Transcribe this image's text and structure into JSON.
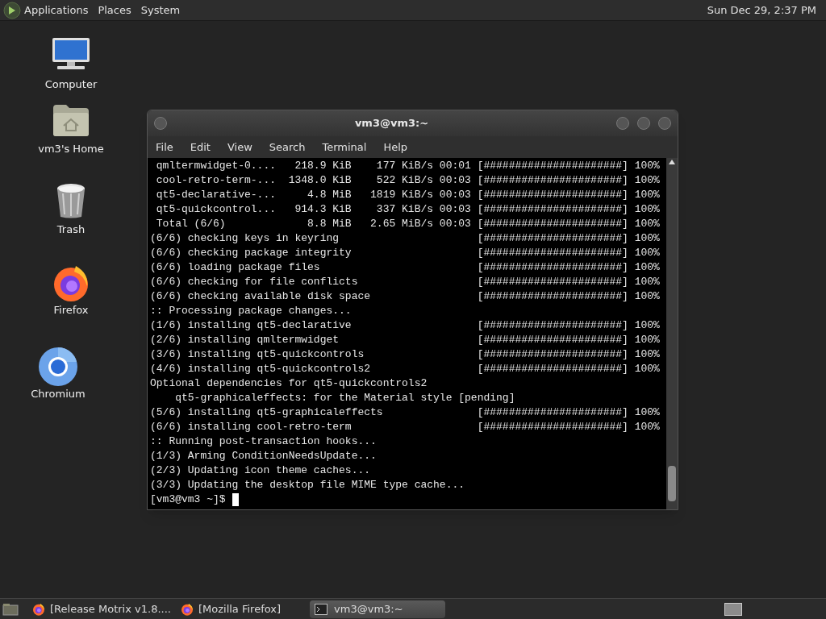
{
  "top_panel": {
    "menus": [
      "Applications",
      "Places",
      "System"
    ],
    "clock": "Sun Dec 29, 2:37 PM"
  },
  "desktop_icons": [
    {
      "kind": "computer",
      "label": "Computer"
    },
    {
      "kind": "home",
      "label": "vm3's Home"
    },
    {
      "kind": "trash",
      "label": "Trash"
    },
    {
      "kind": "firefox",
      "label": "Firefox"
    },
    {
      "kind": "chromium",
      "label": "Chromium"
    }
  ],
  "terminal_window": {
    "title": "vm3@vm3:~",
    "menus": [
      "File",
      "Edit",
      "View",
      "Search",
      "Terminal",
      "Help"
    ],
    "lines": [
      {
        "text": " qmltermwidget-0....   218.9 KiB    177 KiB/s 00:01",
        "bar": "[######################] 100%"
      },
      {
        "text": " cool-retro-term-...  1348.0 KiB    522 KiB/s 00:03",
        "bar": "[######################] 100%"
      },
      {
        "text": " qt5-declarative-...     4.8 MiB   1819 KiB/s 00:03",
        "bar": "[######################] 100%"
      },
      {
        "text": " qt5-quickcontrol...   914.3 KiB    337 KiB/s 00:03",
        "bar": "[######################] 100%"
      },
      {
        "text": " Total (6/6)             8.8 MiB   2.65 MiB/s 00:03",
        "bar": "[######################] 100%"
      },
      {
        "text": "(6/6) checking keys in keyring",
        "bar": "[######################] 100%"
      },
      {
        "text": "(6/6) checking package integrity",
        "bar": "[######################] 100%"
      },
      {
        "text": "(6/6) loading package files",
        "bar": "[######################] 100%"
      },
      {
        "text": "(6/6) checking for file conflicts",
        "bar": "[######################] 100%"
      },
      {
        "text": "(6/6) checking available disk space",
        "bar": "[######################] 100%"
      },
      {
        "text": ":: Processing package changes..."
      },
      {
        "text": "(1/6) installing qt5-declarative",
        "bar": "[######################] 100%"
      },
      {
        "text": "(2/6) installing qmltermwidget",
        "bar": "[######################] 100%"
      },
      {
        "text": "(3/6) installing qt5-quickcontrols",
        "bar": "[######################] 100%"
      },
      {
        "text": "(4/6) installing qt5-quickcontrols2",
        "bar": "[######################] 100%"
      },
      {
        "text": "Optional dependencies for qt5-quickcontrols2"
      },
      {
        "text": "    qt5-graphicaleffects: for the Material style [pending]"
      },
      {
        "text": "(5/6) installing qt5-graphicaleffects",
        "bar": "[######################] 100%"
      },
      {
        "text": "(6/6) installing cool-retro-term",
        "bar": "[######################] 100%"
      },
      {
        "text": ":: Running post-transaction hooks..."
      },
      {
        "text": "(1/3) Arming ConditionNeedsUpdate..."
      },
      {
        "text": "(2/3) Updating icon theme caches..."
      },
      {
        "text": "(3/3) Updating the desktop file MIME type cache..."
      }
    ],
    "prompt": "[vm3@vm3 ~]$"
  },
  "taskbar": {
    "tasks": [
      {
        "kind": "firefox",
        "label": "[Release Motrix v1.8....",
        "selected": false
      },
      {
        "kind": "firefox",
        "label": "[Mozilla Firefox]",
        "selected": false
      },
      {
        "kind": "terminal",
        "label": "vm3@vm3:~",
        "selected": true
      }
    ]
  }
}
